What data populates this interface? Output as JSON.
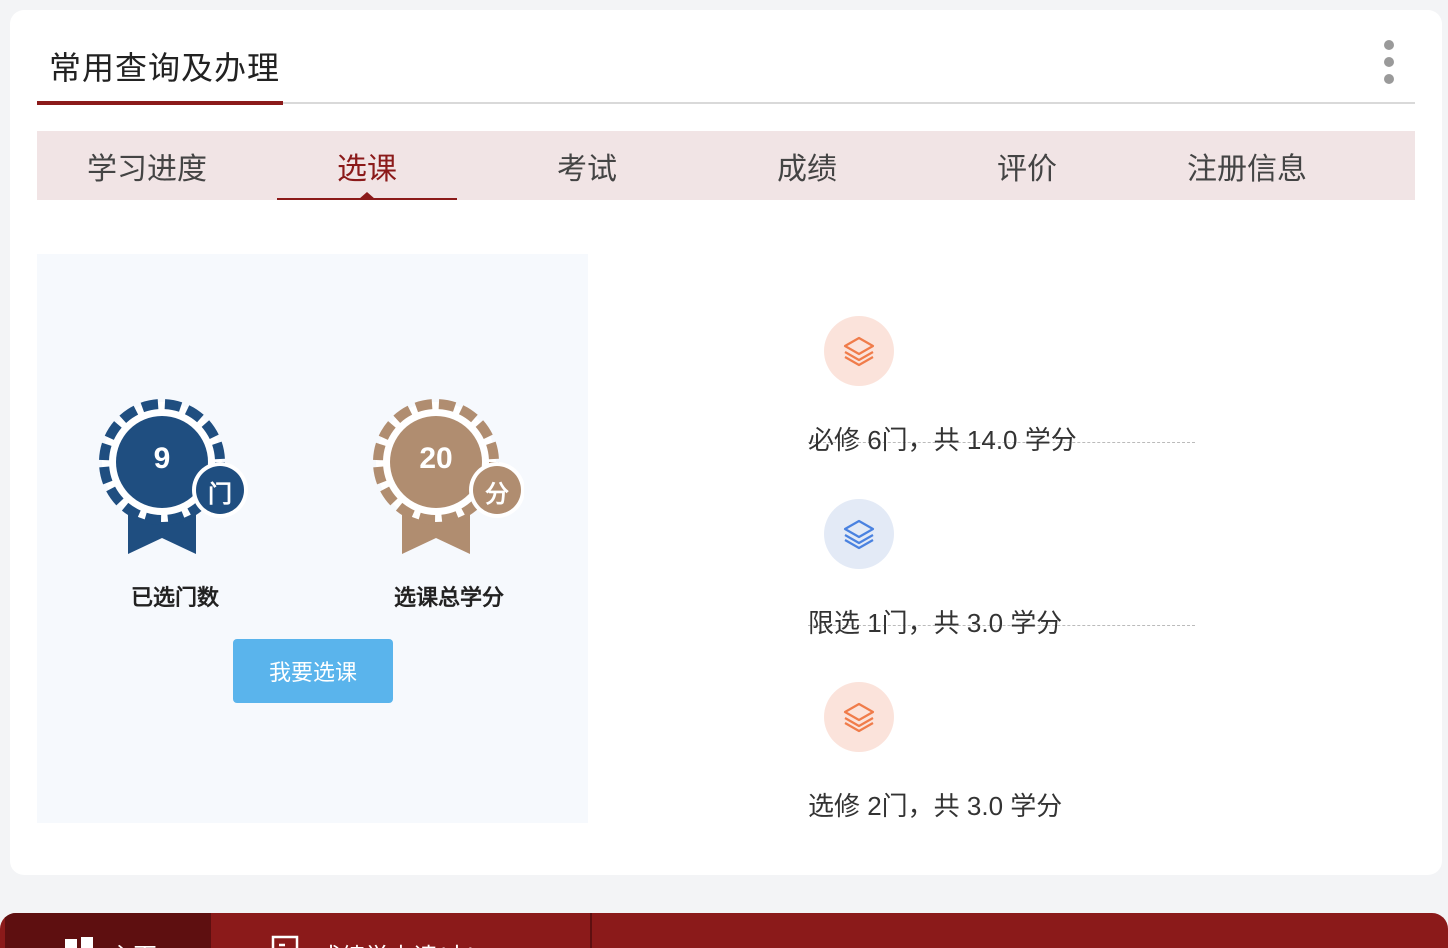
{
  "card": {
    "title": "常用查询及办理"
  },
  "tabs": [
    {
      "label": "学习进度",
      "active": false
    },
    {
      "label": "选课",
      "active": true
    },
    {
      "label": "考试",
      "active": false
    },
    {
      "label": "成绩",
      "active": false
    },
    {
      "label": "评价",
      "active": false
    },
    {
      "label": "注册信息",
      "active": false
    }
  ],
  "summary": {
    "courses": {
      "value": "9",
      "unit": "门",
      "label": "已选门数",
      "color": "#1f4e80"
    },
    "credits": {
      "value": "20",
      "unit": "分",
      "label": "选课总学分",
      "color": "#b08d70"
    },
    "select_button": "我要选课"
  },
  "stats": [
    {
      "text": "必修 6门，共 14.0 学分",
      "icon": "layers-icon",
      "color": "#f07c4a",
      "bg": "#fbe3db"
    },
    {
      "text": "限选 1门，共 3.0 学分",
      "icon": "layers-icon",
      "color": "#4a82e0",
      "bg": "#e3eaf6"
    },
    {
      "text": "选修 2门，共 3.0 学分",
      "icon": "layers-icon",
      "color": "#f07c4a",
      "bg": "#fbe3db"
    }
  ],
  "bottom_nav": [
    {
      "label": "主页",
      "icon": "home-icon"
    },
    {
      "label": "成绩単申请(中)",
      "icon": "document-icon"
    }
  ]
}
